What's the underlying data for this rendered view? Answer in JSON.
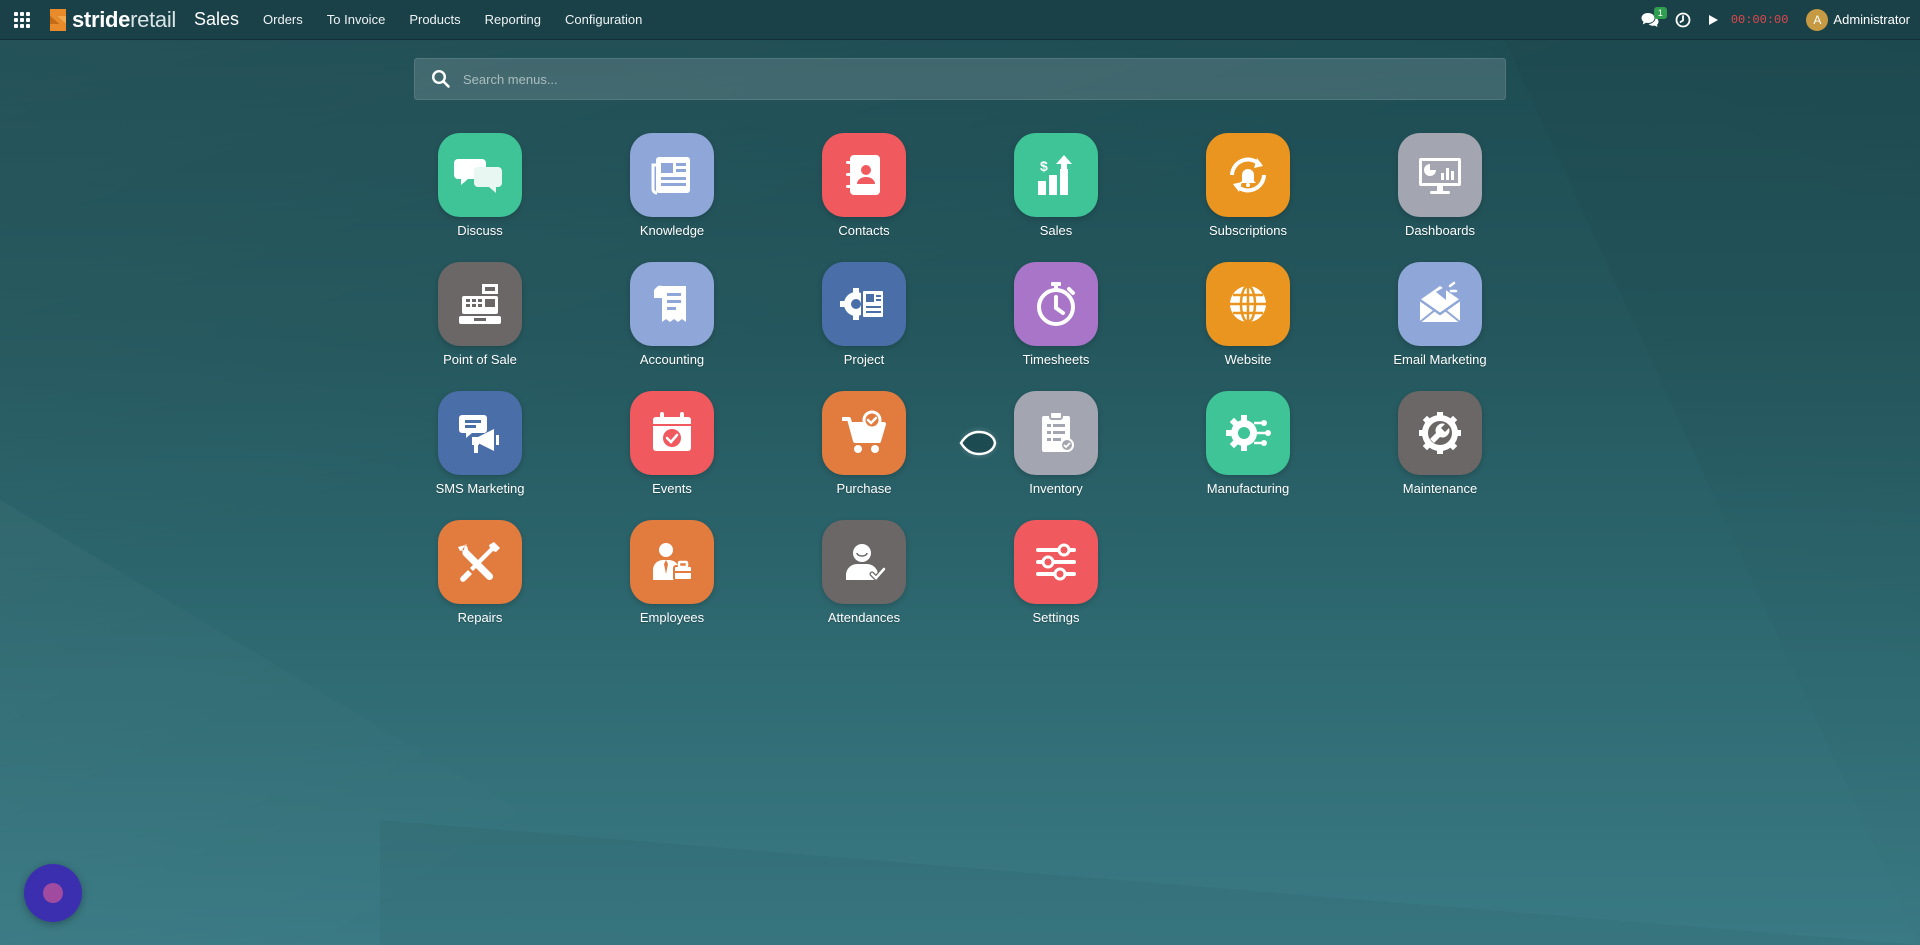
{
  "navbar": {
    "brand_bold": "stride",
    "brand_light": "retail",
    "app_name": "Sales",
    "menu": [
      "Orders",
      "To Invoice",
      "Products",
      "Reporting",
      "Configuration"
    ],
    "messages_badge": "1",
    "timer": "00:00:00",
    "user_initial": "A",
    "user_name": "Administrator"
  },
  "search": {
    "placeholder": "Search menus..."
  },
  "apps": [
    {
      "label": "Discuss",
      "color": "#3ec497",
      "icon": "chat-bubbles-icon"
    },
    {
      "label": "Knowledge",
      "color": "#8ea7d8",
      "icon": "newspaper-icon"
    },
    {
      "label": "Contacts",
      "color": "#f05a5e",
      "icon": "address-book-icon"
    },
    {
      "label": "Sales",
      "color": "#3ec497",
      "icon": "bar-chart-icon"
    },
    {
      "label": "Subscriptions",
      "color": "#e9951f",
      "icon": "recurring-bell-icon"
    },
    {
      "label": "Dashboards",
      "color": "#a3a6b0",
      "icon": "monitor-chart-icon"
    },
    {
      "label": "Point of Sale",
      "color": "#6a6766",
      "icon": "cash-register-icon"
    },
    {
      "label": "Accounting",
      "color": "#8ea7d8",
      "icon": "receipt-icon"
    },
    {
      "label": "Project",
      "color": "#4a6ea8",
      "icon": "gear-document-icon"
    },
    {
      "label": "Timesheets",
      "color": "#a975c9",
      "icon": "stopwatch-icon"
    },
    {
      "label": "Website",
      "color": "#e9951f",
      "icon": "globe-icon"
    },
    {
      "label": "Email Marketing",
      "color": "#8ea7d8",
      "icon": "envelope-megaphone-icon"
    },
    {
      "label": "SMS Marketing",
      "color": "#4a6ea8",
      "icon": "sms-megaphone-icon"
    },
    {
      "label": "Events",
      "color": "#f05a5e",
      "icon": "calendar-check-icon"
    },
    {
      "label": "Purchase",
      "color": "#e27b3e",
      "icon": "shopping-cart-icon"
    },
    {
      "label": "Inventory",
      "color": "#a3a6b0",
      "icon": "clipboard-checklist-icon"
    },
    {
      "label": "Manufacturing",
      "color": "#3ec497",
      "icon": "gear-circuit-icon"
    },
    {
      "label": "Maintenance",
      "color": "#6a6766",
      "icon": "gear-wrench-icon"
    },
    {
      "label": "Repairs",
      "color": "#e27b3e",
      "icon": "wrench-screwdriver-icon"
    },
    {
      "label": "Employees",
      "color": "#e27b3e",
      "icon": "employee-briefcase-icon"
    },
    {
      "label": "Attendances",
      "color": "#6a6766",
      "icon": "user-check-icon"
    },
    {
      "label": "Settings",
      "color": "#f05a5e",
      "icon": "sliders-icon"
    }
  ]
}
